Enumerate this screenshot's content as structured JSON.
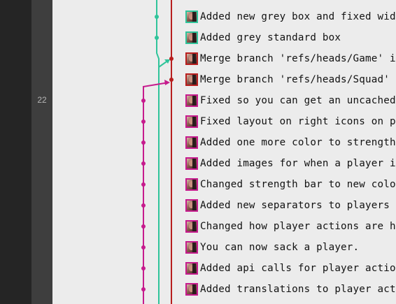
{
  "sidebar": {
    "line_number": "22"
  },
  "colors": {
    "teal": "#2fc49a",
    "red": "#b81e1e",
    "magenta": "#c61b8d"
  },
  "commits": [
    {
      "message": "Added new grey box and fixed width",
      "branch": "teal"
    },
    {
      "message": "Added grey standard box",
      "branch": "teal"
    },
    {
      "message": "Merge branch 'refs/heads/Game' into",
      "branch": "red"
    },
    {
      "message": "Merge branch 'refs/heads/Squad' int",
      "branch": "red"
    },
    {
      "message": "Fixed so you can get an uncached ve",
      "branch": "magenta"
    },
    {
      "message": "Fixed layout on right icons on play",
      "branch": "magenta"
    },
    {
      "message": "Added one more color to strength ba",
      "branch": "magenta"
    },
    {
      "message": "Added images for when a player is l",
      "branch": "magenta"
    },
    {
      "message": "Changed strength bar to new color t",
      "branch": "magenta"
    },
    {
      "message": "Added new separators to players tab",
      "branch": "magenta"
    },
    {
      "message": "Changed how player actions are hand",
      "branch": "magenta"
    },
    {
      "message": "You can now sack a player.",
      "branch": "magenta"
    },
    {
      "message": "Added api calls for player actions",
      "branch": "magenta"
    },
    {
      "message": "Added translations to player action",
      "branch": "magenta"
    }
  ]
}
